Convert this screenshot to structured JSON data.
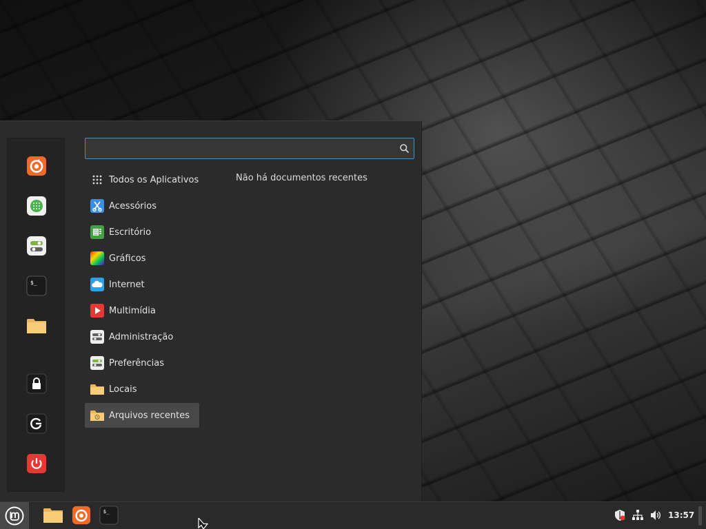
{
  "search": {
    "placeholder": "",
    "value": ""
  },
  "favorites": [
    {
      "name": "firefox-icon"
    },
    {
      "name": "software-manager-icon"
    },
    {
      "name": "system-settings-icon"
    },
    {
      "name": "terminal-icon"
    },
    {
      "name": "files-folder-icon"
    },
    {
      "name": "lock-screen-icon"
    },
    {
      "name": "logout-icon"
    },
    {
      "name": "shutdown-icon"
    }
  ],
  "categories": [
    {
      "label": "Todos os Aplicativos",
      "icon": "all-apps-grid-icon"
    },
    {
      "label": "Acessórios",
      "icon": "accessories-icon"
    },
    {
      "label": "Escritório",
      "icon": "office-icon"
    },
    {
      "label": "Gráficos",
      "icon": "graphics-icon"
    },
    {
      "label": "Internet",
      "icon": "internet-cloud-icon"
    },
    {
      "label": "Multimídia",
      "icon": "multimedia-icon"
    },
    {
      "label": "Administração",
      "icon": "administration-icon"
    },
    {
      "label": "Preferências",
      "icon": "preferences-icon"
    },
    {
      "label": "Locais",
      "icon": "places-folder-icon"
    },
    {
      "label": "Arquivos recentes",
      "icon": "recent-files-icon",
      "selected": true
    }
  ],
  "recent": {
    "empty_message": "Não há documentos recentes"
  },
  "taskbar": {
    "launchers": [
      "files-folder-icon",
      "firefox-icon",
      "terminal-icon"
    ],
    "tray": [
      "update-shield-icon",
      "network-icon",
      "volume-icon"
    ],
    "clock": "13:57"
  },
  "colors": {
    "menu_bg": "#2b2b2b",
    "search_border": "#4a8fb8",
    "selected_bg": "#484848",
    "taskbar_bg": "#2a2a2a"
  }
}
